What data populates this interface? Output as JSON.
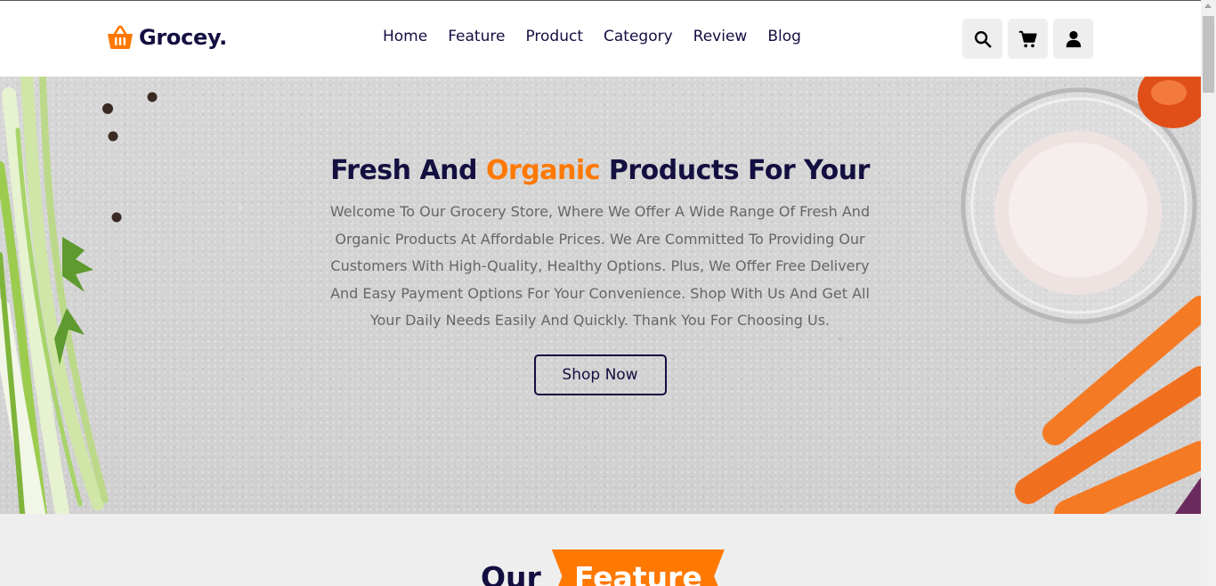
{
  "brand": {
    "name": "Grocey.",
    "icon": "basket-icon",
    "accent": "#ff7800",
    "primary": "#130f40"
  },
  "nav": {
    "items": [
      "Home",
      "Feature",
      "Product",
      "Category",
      "Review",
      "Blog"
    ]
  },
  "header_icons": [
    "search-icon",
    "cart-icon",
    "user-icon"
  ],
  "hero": {
    "title_before": "Fresh And",
    "title_accent": "Organic",
    "title_after": "Products For Your",
    "description": "Welcome To Our Grocery Store, Where We Offer A Wide Range Of Fresh And Organic Products At Affordable Prices. We Are Committed To Providing Our Customers With High-Quality, Healthy Options. Plus, We Offer Free Delivery And Easy Payment Options For Your Convenience. Shop With Us And Get All Your Daily Needs Easily And Quickly. Thank You For Choosing Us.",
    "button": "Shop Now"
  },
  "features": {
    "heading_plain": "Our",
    "heading_tag": "Feature"
  }
}
